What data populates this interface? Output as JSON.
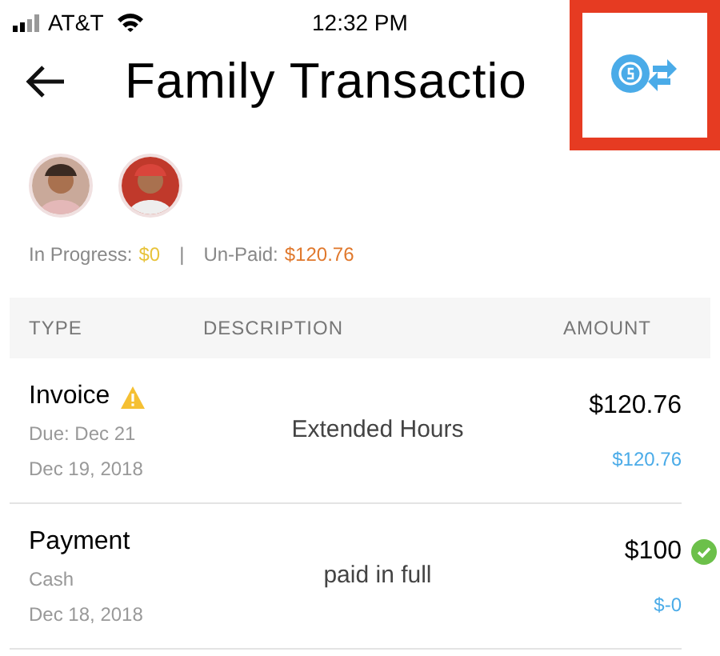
{
  "status_bar": {
    "carrier": "AT&T",
    "time": "12:32 PM"
  },
  "header": {
    "title": "Family Transactio",
    "highlighted_action": true
  },
  "summary": {
    "in_progress_label": "In Progress:",
    "in_progress_value": "$0",
    "separator": "|",
    "unpaid_label": "Un-Paid:",
    "unpaid_value": "$120.76"
  },
  "table": {
    "columns": [
      "TYPE",
      "DESCRIPTION",
      "AMOUNT"
    ],
    "rows": [
      {
        "type": "Invoice",
        "kind": "warning",
        "detail": "Due: Dec 21",
        "date": "Dec 19, 2018",
        "description": "Extended Hours",
        "amount": "$120.76",
        "balance": "$120.76"
      },
      {
        "type": "Payment",
        "kind": "paid",
        "detail": "Cash",
        "date": "Dec 18, 2018",
        "description": "paid in full",
        "amount": "$100",
        "balance": "$-0"
      }
    ]
  }
}
